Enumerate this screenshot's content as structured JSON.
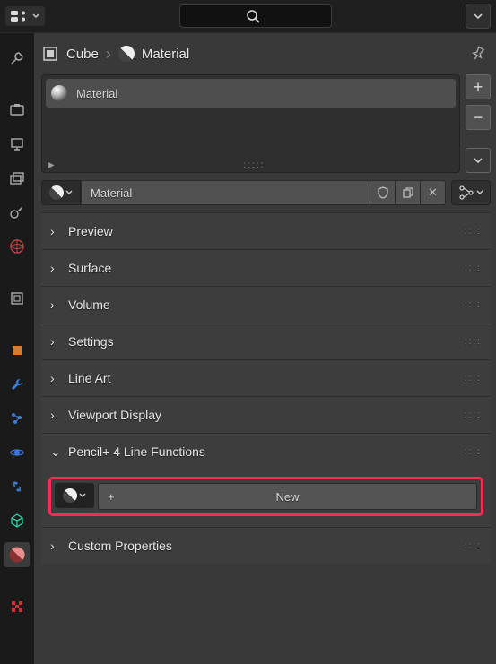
{
  "topbar": {
    "search_placeholder": ""
  },
  "breadcrumb": {
    "object": "Cube",
    "material": "Material"
  },
  "slots": {
    "item0": "Material"
  },
  "datablock": {
    "name": "Material"
  },
  "panels": {
    "preview": "Preview",
    "surface": "Surface",
    "volume": "Volume",
    "settings": "Settings",
    "lineart": "Line Art",
    "viewport": "Viewport Display",
    "pencil": "Pencil+ 4 Line Functions",
    "custom": "Custom Properties"
  },
  "pencil_panel": {
    "new_label": "New"
  },
  "icons": {
    "plus": "+",
    "minus": "−",
    "caret_down": "⌄",
    "play": "▶",
    "x": "✕",
    "chev_right": "›",
    "chev_down": "⌄"
  },
  "colors": {
    "highlight": "#fc2c55"
  }
}
